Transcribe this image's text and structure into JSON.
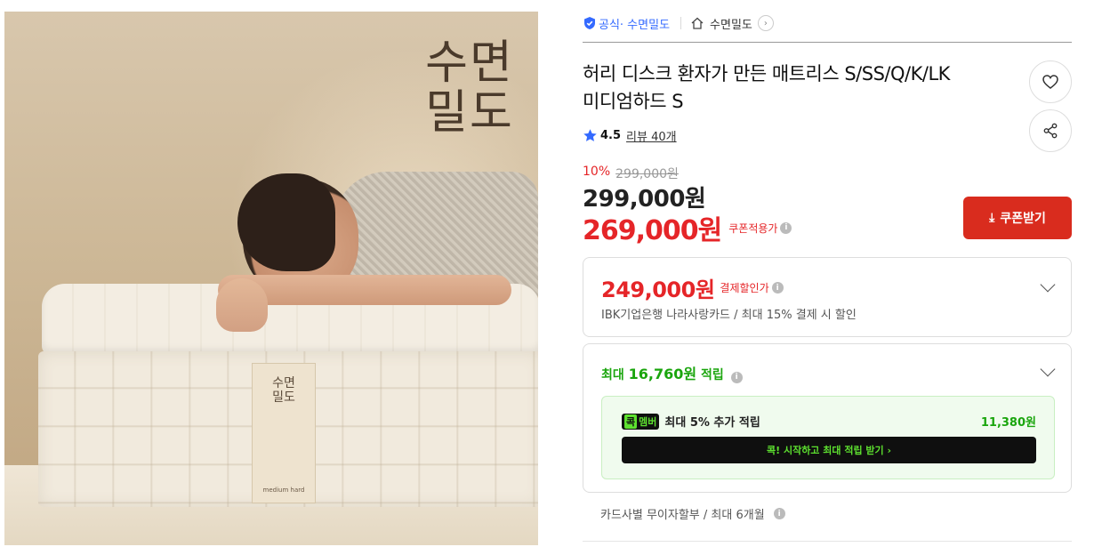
{
  "photo": {
    "brand_lines": [
      "수면",
      "밀도"
    ],
    "tag_brand_lines": [
      "수면",
      "밀도"
    ],
    "tag_label": "medium hard"
  },
  "breadcrumb": {
    "official_label": "공식",
    "official_store": "· 수면밀도",
    "store_name": "수면밀도"
  },
  "product": {
    "title_line1": "허리 디스크 환자가 만든 매트리스 S/SS/Q/K/LK",
    "title_line2": "미디엄하드 S",
    "rating": "4.5",
    "reviews": "리뷰 40개"
  },
  "price": {
    "discount_pct": "10%",
    "original": "299,000원",
    "current": "299,000원",
    "coupon_price": "269,000원",
    "coupon_note": "쿠폰적용가",
    "coupon_button": "쿠폰받기"
  },
  "card_discount": {
    "amount": "249,000원",
    "label": "결제할인가",
    "description": "IBK기업은행 나라사랑카드 / 최대 15% 결제 시 할인"
  },
  "reward": {
    "prefix": "최대 ",
    "amount": "16,760원",
    "suffix": " 적립",
    "member_badge_k": "콕",
    "member_badge_m": "멤버",
    "member_desc": "최대 5% 추가 적립",
    "member_points": "11,380원",
    "member_cta": "콕! 시작하고 최대 적립 받기  ›"
  },
  "installment": {
    "text": "카드사별 무이자할부 / 최대 6개월"
  },
  "colors": {
    "accent_red": "#e52528",
    "accent_blue": "#346aff",
    "reward_green": "#1aa50d",
    "member_green": "#5de02f"
  },
  "icons": [
    "shield-check-icon",
    "home-icon",
    "chevron-right-icon",
    "heart-icon",
    "share-icon",
    "star-icon",
    "download-icon",
    "info-icon",
    "chevron-down-icon"
  ]
}
